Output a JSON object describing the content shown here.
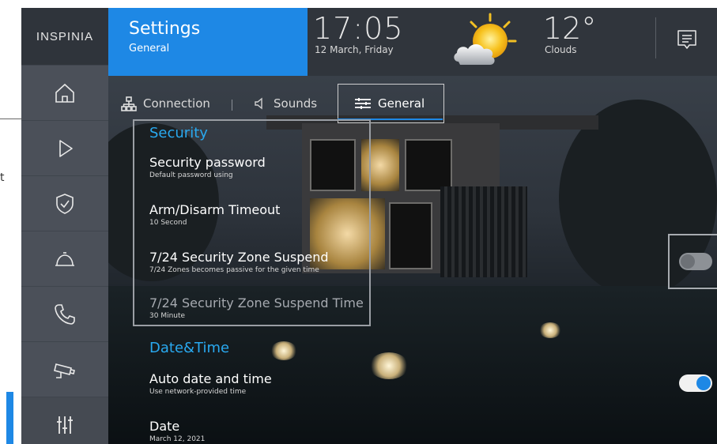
{
  "outside": {
    "label": "t"
  },
  "sidebar": {
    "logo": "INSPINIA",
    "items": [
      {
        "name": "home",
        "icon": "home-icon"
      },
      {
        "name": "scenarios",
        "icon": "play-icon"
      },
      {
        "name": "security",
        "icon": "shield-check-icon"
      },
      {
        "name": "services",
        "icon": "service-bell-icon"
      },
      {
        "name": "phone",
        "icon": "phone-icon"
      },
      {
        "name": "camera",
        "icon": "camera-icon"
      },
      {
        "name": "settings",
        "icon": "sliders-icon"
      }
    ]
  },
  "header": {
    "title": "Settings",
    "subtitle": "General",
    "time": "17:05",
    "date": "12 March, Friday",
    "temperature": "12°",
    "weather": "Clouds",
    "weather_icon": "sun-cloud-icon",
    "message_icon": "message-icon"
  },
  "tabs": [
    {
      "label": "Connection",
      "icon": "network-icon",
      "active": false
    },
    {
      "label": "Sounds",
      "icon": "speaker-icon",
      "active": false
    },
    {
      "label": "General",
      "icon": "sliders-horizontal-icon",
      "active": true
    }
  ],
  "sections": {
    "security": {
      "title": "Security",
      "items": [
        {
          "label": "Security password",
          "desc": "Default password using"
        },
        {
          "label": "Arm/Disarm Timeout",
          "desc": "10 Second"
        },
        {
          "label": "7/24 Security Zone Suspend",
          "desc": "7/24 Zones becomes passive for the given time",
          "toggle": false
        },
        {
          "label": "7/24 Security Zone Suspend Time",
          "desc": "30 Minute"
        }
      ]
    },
    "datetime": {
      "title": "Date&Time",
      "items": [
        {
          "label": "Auto date and time",
          "desc": "Use network-provided time",
          "toggle": true
        },
        {
          "label": "Date",
          "desc": "March 12, 2021"
        }
      ]
    }
  },
  "colors": {
    "accent": "#1e88e5",
    "section": "#29a9f0"
  }
}
